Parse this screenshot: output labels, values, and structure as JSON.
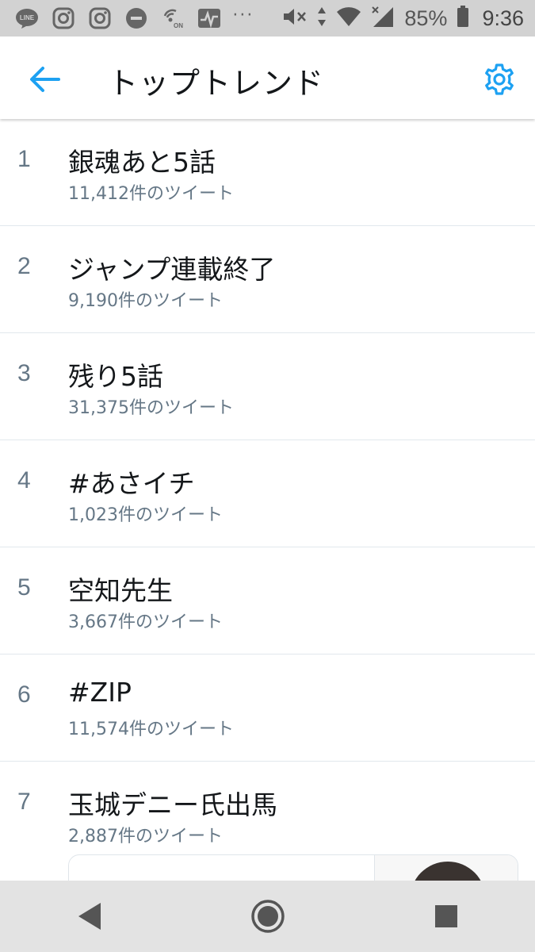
{
  "status_bar": {
    "icons_left": [
      "line-icon",
      "instagram-icon",
      "instagram-icon",
      "do-not-disturb-icon",
      "nfc-on-icon",
      "activity-icon"
    ],
    "overflow": "···",
    "battery_percent": "85%",
    "time": "9:36"
  },
  "header": {
    "title": "トップトレンド",
    "accent_color": "#1da1f2"
  },
  "trends": [
    {
      "rank": "1",
      "name": "銀魂あと5話",
      "count": "11,412件のツイート"
    },
    {
      "rank": "2",
      "name": "ジャンプ連載終了",
      "count": "9,190件のツイート"
    },
    {
      "rank": "3",
      "name": "残り5話",
      "count": "31,375件のツイート"
    },
    {
      "rank": "4",
      "name": "#あさイチ",
      "count": "1,023件のツイート"
    },
    {
      "rank": "5",
      "name": "空知先生",
      "count": "3,667件のツイート"
    },
    {
      "rank": "6",
      "name": "#ZIP",
      "count": "11,574件のツイート"
    },
    {
      "rank": "7",
      "name": "玉城デニー氏出馬",
      "count": "2,887件のツイート"
    }
  ],
  "nav": {
    "back": "back-triangle-icon",
    "home": "home-circle-icon",
    "recents": "recents-square-icon"
  }
}
